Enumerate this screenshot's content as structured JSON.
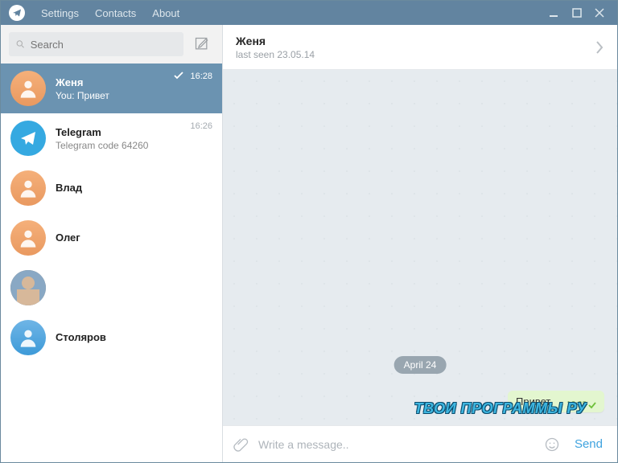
{
  "titlebar": {
    "menu": [
      "Settings",
      "Contacts",
      "About"
    ]
  },
  "search": {
    "placeholder": "Search"
  },
  "chats": [
    {
      "name": "Женя",
      "preview": "You: Привет",
      "time": "16:28",
      "avatar": "orange",
      "checked": true,
      "selected": true
    },
    {
      "name": "Telegram",
      "preview": "Telegram code 64260",
      "time": "16:26",
      "avatar": "telegram",
      "checked": false,
      "selected": false
    },
    {
      "name": "Влад",
      "preview": "",
      "time": "",
      "avatar": "orange",
      "checked": false,
      "selected": false
    },
    {
      "name": "Олег",
      "preview": "",
      "time": "",
      "avatar": "orange",
      "checked": false,
      "selected": false
    },
    {
      "name": "",
      "preview": "",
      "time": "",
      "avatar": "photo",
      "checked": false,
      "selected": false
    },
    {
      "name": "Столяров",
      "preview": "",
      "time": "",
      "avatar": "blue",
      "checked": false,
      "selected": false
    }
  ],
  "header": {
    "name": "Женя",
    "status": "last seen 23.05.14"
  },
  "conversation": {
    "date_label": "April 24",
    "messages": [
      {
        "text": "Привет",
        "time": "16:28",
        "out": true,
        "checked": true
      }
    ]
  },
  "compose": {
    "placeholder": "Write a message..",
    "send": "Send"
  },
  "watermark": "ТВОИ ПРОГРАММЫ РУ"
}
